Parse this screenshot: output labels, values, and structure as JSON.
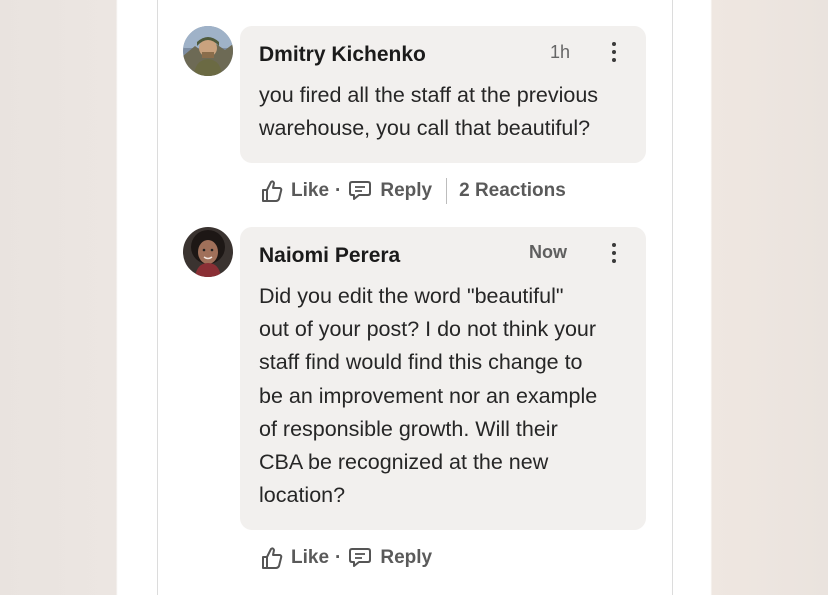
{
  "comments": [
    {
      "author": "Dmitry Kichenko",
      "time": "1h",
      "lines": [
        "you fired all the staff at the previous",
        "warehouse, you call that beautiful?"
      ],
      "actions": {
        "like": "Like",
        "dot": "·",
        "reply": "Reply",
        "reactions": "2 Reactions"
      }
    },
    {
      "author": "Naiomi Perera",
      "time": "Now",
      "lines": [
        "Did you edit the word \"beautiful\"",
        "out of your post? I do not think your",
        "staff find would find this change to",
        "be an improvement nor an example",
        "of responsible growth. Will their",
        "CBA be recognized at the new",
        "location?"
      ],
      "actions": {
        "like": "Like",
        "dot": "·",
        "reply": "Reply"
      }
    }
  ],
  "icons": {
    "like": "thumbs-up-icon",
    "reply": "speech-bubble-icon",
    "more": "more-vertical-icon"
  }
}
